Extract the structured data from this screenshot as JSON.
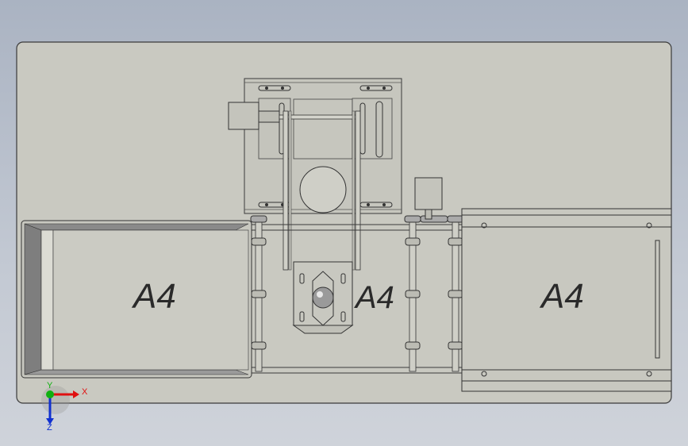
{
  "model_view": {
    "labels": {
      "left_tray": "A4",
      "center": "A4",
      "right_tray": "A4"
    },
    "triad": {
      "x": "X",
      "y": "Y",
      "z": "Z"
    },
    "colors": {
      "background_top": "#aab3c2",
      "plate": "#c8c8c0",
      "line": "#3a3a3a",
      "axis_x": "#e01010",
      "axis_y": "#10b010",
      "axis_z": "#1030d0"
    }
  }
}
